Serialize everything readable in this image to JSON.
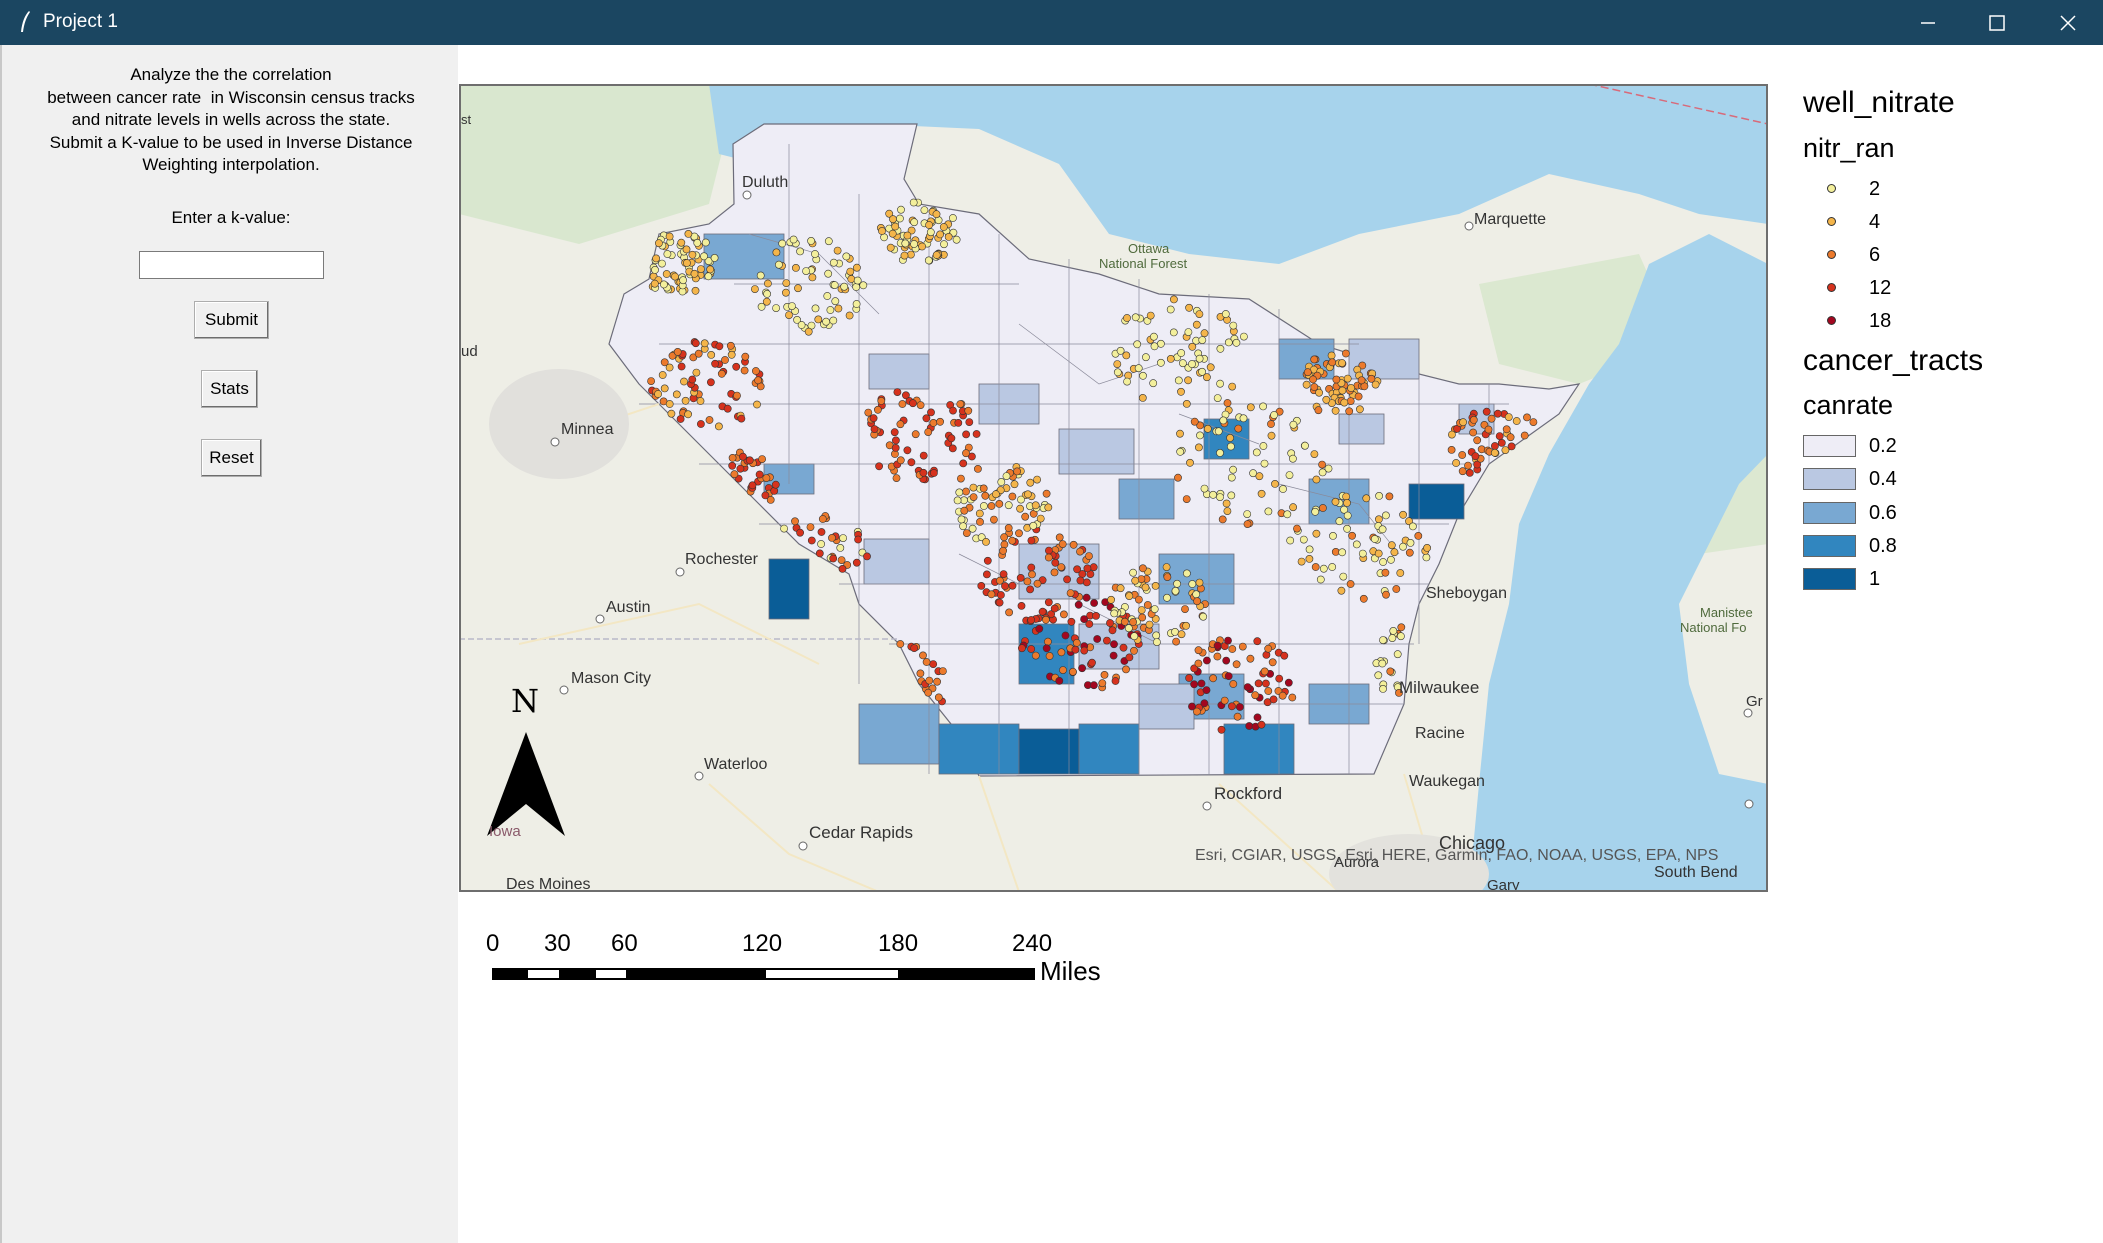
{
  "window": {
    "title": "Project 1",
    "controls": {
      "minimize": "minimize-icon",
      "maximize": "maximize-icon",
      "close": "close-icon"
    }
  },
  "panel": {
    "description_lines": [
      "Analyze the the correlation",
      "between cancer rate  in Wisconsin census tracks",
      "and nitrate levels in wells across the state.",
      "Submit a K-value to be used in Inverse Distance",
      "Weighting interpolation."
    ],
    "k_label": "Enter a k-value:",
    "k_value": "",
    "submit_label": "Submit",
    "stats_label": "Stats",
    "reset_label": "Reset"
  },
  "map": {
    "north_label": "N",
    "attribution": "Esri, CGIAR, USGS, Esri, HERE, Garmin, FAO, NOAA, USGS, EPA, NPS",
    "places": {
      "duluth": "Duluth",
      "marquette": "Marquette",
      "ottawa": "Ottawa",
      "national_forest": "National Forest",
      "minneapolis": "Minnea",
      "rochester": "Rochester",
      "austin": "Austin",
      "mason_city": "Mason City",
      "waterloo": "Waterloo",
      "cedar_rapids": "Cedar Rapids",
      "des_moines": "Des Moines",
      "rockford": "Rockford",
      "chicago": "Chicago",
      "aurora": "Aurora",
      "gary": "Gary",
      "south_bend": "South Bend",
      "sheboygan": "Sheboygan",
      "milwaukee": "Milwaukee",
      "racine": "Racine",
      "waukegan": "Waukegan",
      "iowa": "Iowa",
      "manistee": "Manistee",
      "manistee_nf": "National Fo",
      "st_edge": "st",
      "ud_edge": "ud",
      "gr_edge": "Gr"
    }
  },
  "legend": {
    "layer1_title": "well_nitrate",
    "layer1_field": "nitr_ran",
    "nitrate_classes": [
      {
        "label": "2",
        "color": "#f3ef9b"
      },
      {
        "label": "4",
        "color": "#f4b54a"
      },
      {
        "label": "6",
        "color": "#ec7a2c"
      },
      {
        "label": "12",
        "color": "#d6321d"
      },
      {
        "label": "18",
        "color": "#a3071f"
      }
    ],
    "layer2_title": "cancer_tracts",
    "layer2_field": "canrate",
    "cancer_classes": [
      {
        "label": "0.2",
        "color": "#eeedf6"
      },
      {
        "label": "0.4",
        "color": "#bac8e2"
      },
      {
        "label": "0.6",
        "color": "#79a8d2"
      },
      {
        "label": "0.8",
        "color": "#3186bf"
      },
      {
        "label": "1",
        "color": "#0a5d97"
      }
    ]
  },
  "scalebar": {
    "ticks": [
      "0",
      "30",
      "60",
      "120",
      "180",
      "240"
    ],
    "unit": "Miles"
  }
}
